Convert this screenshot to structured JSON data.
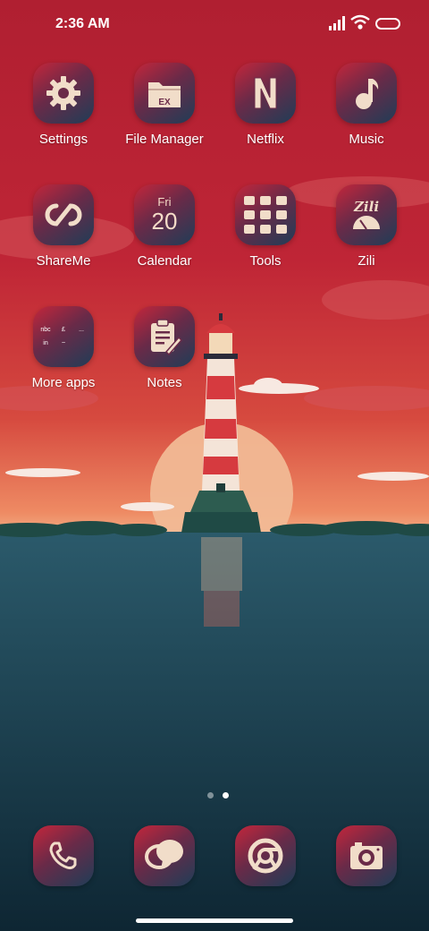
{
  "status_bar": {
    "time": "2:36 AM",
    "icons": [
      "signal-icon",
      "wifi-icon",
      "battery-icon"
    ]
  },
  "apps": [
    {
      "label": "Settings",
      "icon": "gear-icon"
    },
    {
      "label": "File Manager",
      "icon": "folder-icon"
    },
    {
      "label": "Netflix",
      "icon": "netflix-icon"
    },
    {
      "label": "Music",
      "icon": "music-note-icon"
    },
    {
      "label": "ShareMe",
      "icon": "infinity-icon"
    },
    {
      "label": "Calendar",
      "icon": "calendar-icon",
      "day_name": "Fri",
      "day_number": "20"
    },
    {
      "label": "Tools",
      "icon": "tools-folder-icon"
    },
    {
      "label": "Zili",
      "icon": "zili-icon",
      "logo_text": "Zili"
    },
    {
      "label": "More apps",
      "icon": "more-apps-folder-icon"
    },
    {
      "label": "Notes",
      "icon": "notes-icon"
    }
  ],
  "file_manager_badge": "EX",
  "more_apps_icons": [
    "nbc",
    "£",
    "...",
    "in",
    "~"
  ],
  "page_indicator": {
    "pages": 2,
    "current": 2
  },
  "dock": [
    {
      "icon": "phone-icon"
    },
    {
      "icon": "messages-icon"
    },
    {
      "icon": "browser-icon"
    },
    {
      "icon": "camera-icon"
    }
  ],
  "colors": {
    "accent": "#c4263b",
    "icon_dark": "#1f3d57",
    "glyph": "#f1ddc9"
  }
}
